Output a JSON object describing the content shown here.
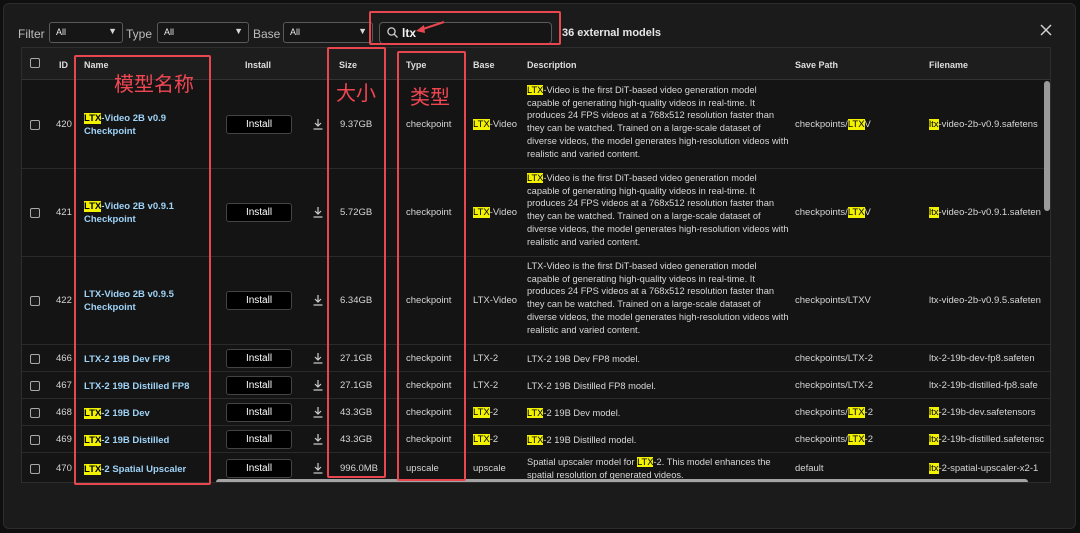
{
  "filters": {
    "filter_label": "Filter",
    "filter_value": "All",
    "type_label": "Type",
    "type_value": "All",
    "base_label": "Base",
    "base_value": "All"
  },
  "search": {
    "value": "ltx",
    "icon": "search-icon"
  },
  "result_count": "36 external models",
  "columns": [
    "ID",
    "Name",
    "Install",
    "Size",
    "Type",
    "Base",
    "Description",
    "Save Path",
    "Filename"
  ],
  "install_label": "Install",
  "rows": [
    {
      "id": "420",
      "name": [
        "LTX",
        "-Video 2B v0.9 Checkpoint"
      ],
      "size": "9.37GB",
      "type": "checkpoint",
      "base": [
        "LTX",
        "-Video"
      ],
      "desc": [
        "LTX",
        "-Video is the first DiT-based video generation model capable of generating high-quality videos in real-time. It produces 24 FPS videos at a 768x512 resolution faster than they can be watched. Trained on a large-scale dataset of diverse videos, the model generates high-resolution videos with realistic and varied content."
      ],
      "save": [
        "checkpoints/",
        "LTX",
        "V"
      ],
      "file": [
        "ltx",
        "-video-2b-v0.9.safetens"
      ]
    },
    {
      "id": "421",
      "name": [
        "LTX",
        "-Video 2B v0.9.1 Checkpoint"
      ],
      "size": "5.72GB",
      "type": "checkpoint",
      "base": [
        "LTX",
        "-Video"
      ],
      "desc": [
        "LTX",
        "-Video is the first DiT-based video generation model capable of generating high-quality videos in real-time. It produces 24 FPS videos at a 768x512 resolution faster than they can be watched. Trained on a large-scale dataset of diverse videos, the model generates high-resolution videos with realistic and varied content."
      ],
      "save": [
        "checkpoints/",
        "LTX",
        "V"
      ],
      "file": [
        "ltx",
        "-video-2b-v0.9.1.safeten"
      ]
    },
    {
      "id": "422",
      "name": [
        "",
        "LTX-Video 2B v0.9.5 Checkpoint"
      ],
      "size": "6.34GB",
      "type": "checkpoint",
      "base": [
        "",
        "LTX-Video"
      ],
      "desc": [
        "",
        "LTX-Video is the first DiT-based video generation model capable of generating high-quality videos in real-time. It produces 24 FPS videos at a 768x512 resolution faster than they can be watched. Trained on a large-scale dataset of diverse videos, the model generates high-resolution videos with realistic and varied content."
      ],
      "save": [
        "checkpoints/LTXV",
        "",
        ""
      ],
      "file": [
        "",
        "ltx-video-2b-v0.9.5.safeten"
      ]
    },
    {
      "id": "466",
      "name": [
        "",
        "LTX-2 19B Dev FP8"
      ],
      "size": "27.1GB",
      "type": "checkpoint",
      "base": [
        "",
        "LTX-2"
      ],
      "desc": [
        "",
        "LTX-2 19B Dev FP8 model."
      ],
      "save": [
        "checkpoints/LTX-2",
        "",
        ""
      ],
      "file": [
        "",
        "ltx-2-19b-dev-fp8.safeten"
      ]
    },
    {
      "id": "467",
      "name": [
        "",
        "LTX-2 19B Distilled FP8"
      ],
      "size": "27.1GB",
      "type": "checkpoint",
      "base": [
        "",
        "LTX-2"
      ],
      "desc": [
        "",
        "LTX-2 19B Distilled FP8 model."
      ],
      "save": [
        "checkpoints/LTX-2",
        "",
        ""
      ],
      "file": [
        "",
        "ltx-2-19b-distilled-fp8.safe"
      ]
    },
    {
      "id": "468",
      "name": [
        "LTX",
        "-2 19B Dev"
      ],
      "size": "43.3GB",
      "type": "checkpoint",
      "base": [
        "LTX",
        "-2"
      ],
      "desc": [
        "LTX",
        "-2 19B Dev model."
      ],
      "save": [
        "checkpoints/",
        "LTX",
        "-2"
      ],
      "file": [
        "ltx",
        "-2-19b-dev.safetensors"
      ]
    },
    {
      "id": "469",
      "name": [
        "LTX",
        "-2 19B Distilled"
      ],
      "size": "43.3GB",
      "type": "checkpoint",
      "base": [
        "LTX",
        "-2"
      ],
      "desc": [
        "LTX",
        "-2 19B Distilled model."
      ],
      "save": [
        "checkpoints/",
        "LTX",
        "-2"
      ],
      "file": [
        "ltx",
        "-2-19b-distilled.safetensc"
      ]
    },
    {
      "id": "470",
      "name": [
        "LTX",
        "-2 Spatial Upscaler"
      ],
      "size": "996.0MB",
      "type": "upscale",
      "base": [
        "",
        "upscale"
      ],
      "desc": [
        "Spatial upscaler model for ",
        "LTX",
        "-2. This model enhances the spatial resolution of generated videos."
      ],
      "save": [
        "default",
        "",
        ""
      ],
      "file": [
        "ltx",
        "-2-spatial-upscaler-x2-1"
      ]
    }
  ],
  "annotations": {
    "name_label": "模型名称",
    "size_label": "大小",
    "type_label": "类型"
  },
  "colors": {
    "highlight": "#f2f200",
    "annotation": "#e8474f",
    "model_name": "#9fd3f7"
  }
}
